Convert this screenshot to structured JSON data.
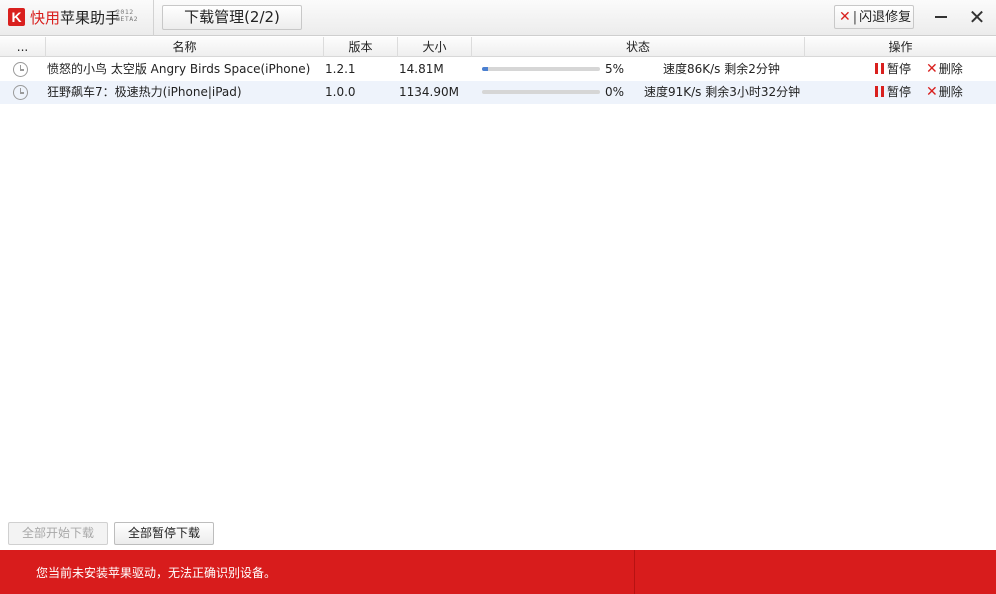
{
  "app": {
    "logo_letter": "K",
    "name_red": "快用",
    "name_dark": "苹果助手",
    "version_line1": "2012",
    "version_line2": "BETA2"
  },
  "toolbar": {
    "download_tab": "下载管理(2/2)",
    "repair_label": "闪退修复",
    "minimize_icon": "minimize-icon",
    "close_icon": "close-icon"
  },
  "table": {
    "headers": [
      "...",
      "名称",
      "版本",
      "大小",
      "状态",
      "操作"
    ],
    "rows": [
      {
        "name": "愤怒的小鸟 太空版 Angry Birds Space(iPhone)",
        "version": "1.2.1",
        "size": "14.81M",
        "progress": 5,
        "percent": "5%",
        "status": "速度86K/s 剩余2分钟",
        "pause": "暂停",
        "delete": "删除"
      },
      {
        "name": "狂野飙车7：极速热力(iPhone|iPad)",
        "version": "1.0.0",
        "size": "1134.90M",
        "progress": 0,
        "percent": "0%",
        "status": "速度91K/s 剩余3小时32分钟",
        "pause": "暂停",
        "delete": "删除"
      }
    ]
  },
  "footer": {
    "start_all": "全部开始下载",
    "pause_all": "全部暂停下载"
  },
  "statusbar": {
    "message": "您当前未安装苹果驱动，无法正确识别设备。"
  },
  "colors": {
    "brand_red": "#d9201e",
    "progress_blue": "#4a7fd0",
    "row_alt": "#eef3fb"
  }
}
